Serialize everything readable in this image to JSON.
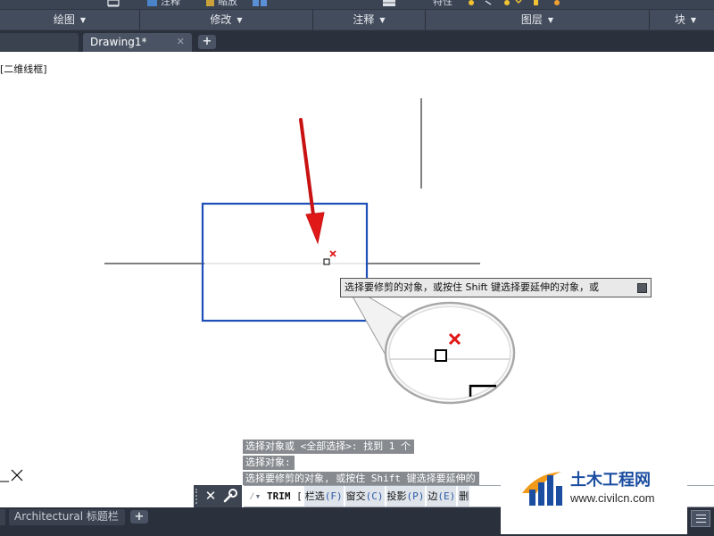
{
  "ribbon": {
    "top_items": [
      "注释",
      "缩放",
      "特性"
    ],
    "panels": [
      "绘图",
      "修改",
      "注释",
      "图层",
      "块"
    ]
  },
  "file_tabs": {
    "current": "Drawing1*",
    "close_glyph": "✕",
    "add_glyph": "+"
  },
  "viewport": {
    "label": "[二维线框]"
  },
  "tooltip": {
    "text": "选择要修剪的对象，或按住 Shift 键选择要延伸的对象，或"
  },
  "command": {
    "history": [
      "选择对象或 <全部选择>:  找到 1 个",
      "选择对象:",
      "选择要修剪的对象, 或按住 Shift 键选择要延伸的"
    ],
    "close_glyph": "✕",
    "prompt_glyph": "⁄▾",
    "name": "TRIM",
    "bracket": "[",
    "options": [
      {
        "label": "栏选",
        "key": "(F)"
      },
      {
        "label": "窗交",
        "key": "(C)"
      },
      {
        "label": "投影",
        "key": "(P)"
      },
      {
        "label": "边",
        "key": "(E)"
      },
      {
        "label": "删",
        "key": ""
      }
    ]
  },
  "layout_tabs": {
    "tab": "Architectural 标题栏",
    "add_glyph": "+"
  },
  "watermark": {
    "title": "土木工程网",
    "url": "www.civilcn.com"
  },
  "colors": {
    "ribbon_bg": "#3b4453",
    "tab_bar_bg": "#2b313c",
    "selection_blue": "#1e4fb8",
    "arrow_red": "#e01818",
    "pickbox_marker": "#e01818",
    "brand_blue": "#1b4da0"
  }
}
